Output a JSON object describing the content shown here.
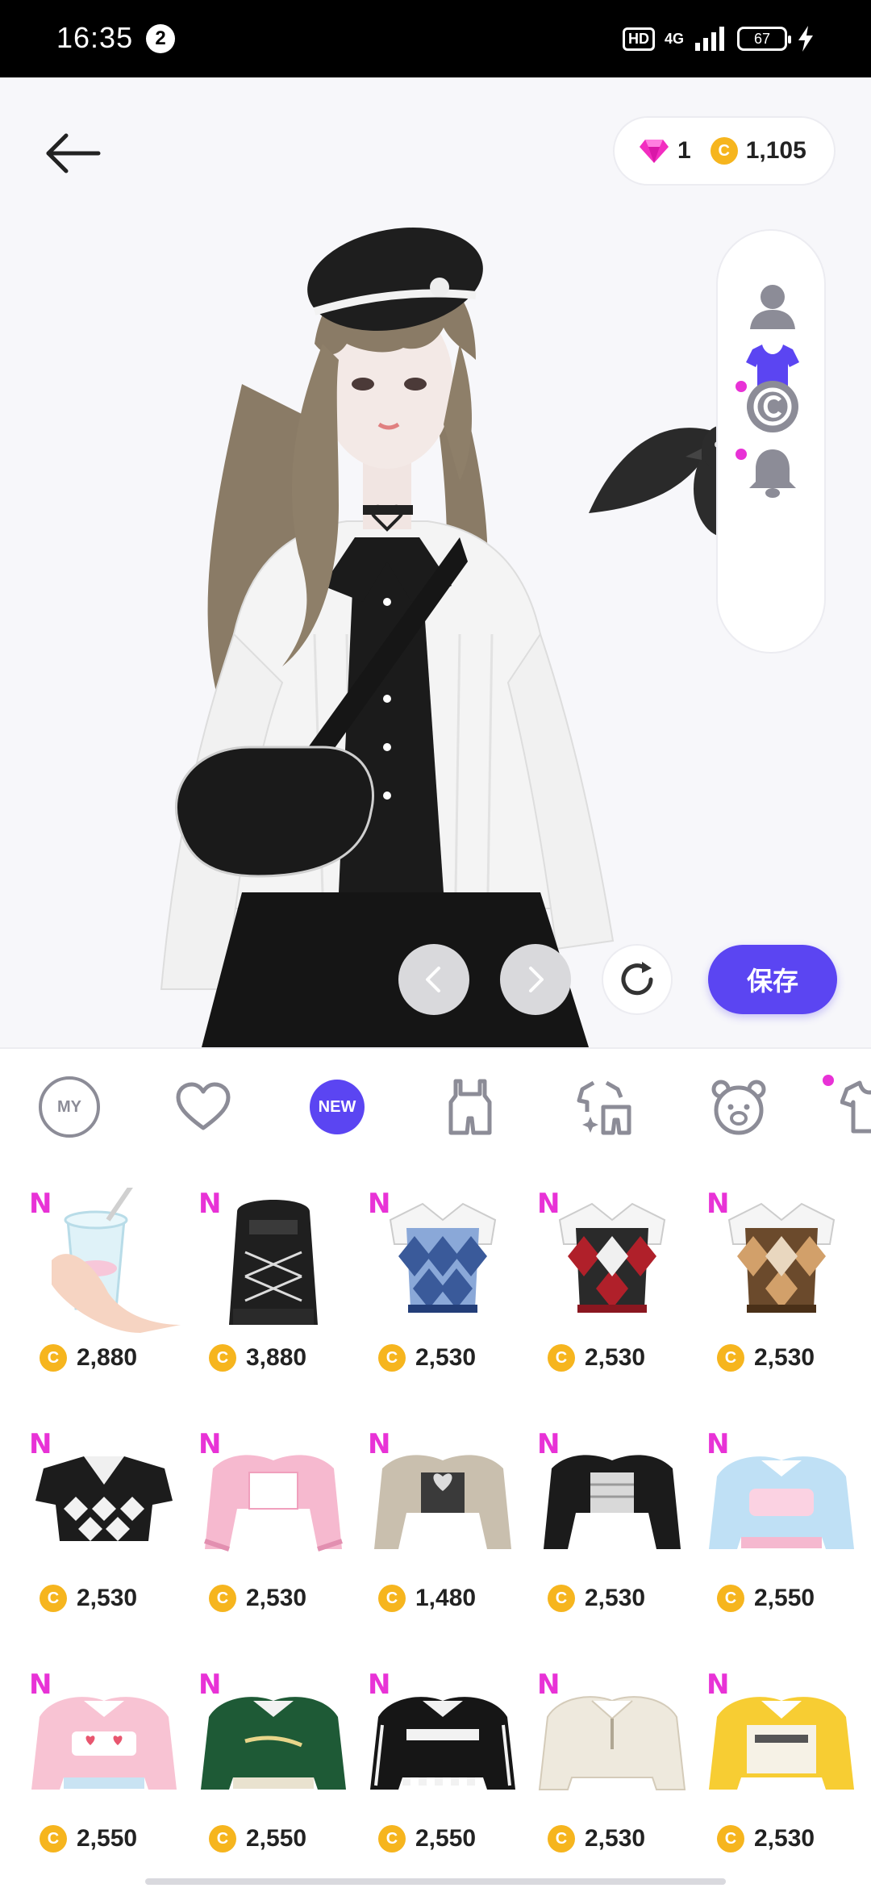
{
  "status_bar": {
    "time": "16:35",
    "notification_count": "2",
    "hd_label": "HD",
    "network_label": "4G",
    "battery_level": "67"
  },
  "header": {
    "gem_count": "1",
    "coin_count": "1,105"
  },
  "side_panel": {
    "items": [
      {
        "icon": "profile-icon",
        "active": false,
        "new_dot": false
      },
      {
        "icon": "shirt-icon",
        "active": true,
        "new_dot": false
      },
      {
        "icon": "copyright-icon",
        "active": false,
        "new_dot": true
      },
      {
        "icon": "bell-icon",
        "active": false,
        "new_dot": true
      }
    ]
  },
  "actions": {
    "save_label": "保存"
  },
  "tabs": [
    {
      "id": "my",
      "label": "MY"
    },
    {
      "id": "favorites",
      "icon": "heart-icon"
    },
    {
      "id": "new",
      "label": "NEW",
      "active": true
    },
    {
      "id": "outfit",
      "icon": "overalls-icon"
    },
    {
      "id": "sets",
      "icon": "sparkle-outfit-icon"
    },
    {
      "id": "animal",
      "icon": "bear-icon"
    },
    {
      "id": "tops",
      "icon": "tshirt-icon",
      "new_dot": true
    }
  ],
  "items": [
    {
      "name": "bubble-tea",
      "badge": "N",
      "price": "2,880"
    },
    {
      "name": "black-backpack",
      "badge": "N",
      "price": "3,880"
    },
    {
      "name": "blue-argyle-vest",
      "badge": "N",
      "price": "2,530"
    },
    {
      "name": "red-argyle-vest",
      "badge": "N",
      "price": "2,530"
    },
    {
      "name": "brown-argyle-vest",
      "badge": "N",
      "price": "2,530"
    },
    {
      "name": "black-argyle-crop",
      "badge": "N",
      "price": "2,530"
    },
    {
      "name": "pink-crop-jacket",
      "badge": "N",
      "price": "2,530"
    },
    {
      "name": "beige-crop-jacket",
      "badge": "N",
      "price": "1,480"
    },
    {
      "name": "black-crop-jacket",
      "badge": "N",
      "price": "2,530"
    },
    {
      "name": "blue-puffer",
      "badge": "N",
      "price": "2,550"
    },
    {
      "name": "pink-puffer",
      "badge": "N",
      "price": "2,550"
    },
    {
      "name": "green-varsity",
      "badge": "N",
      "price": "2,550"
    },
    {
      "name": "black-track-jacket",
      "badge": "N",
      "price": "2,550"
    },
    {
      "name": "cream-pullover",
      "badge": "N",
      "price": "2,530"
    },
    {
      "name": "yellow-puffer",
      "badge": "N",
      "price": "2,530"
    }
  ],
  "colors": {
    "accent": "#5b45f2",
    "badge": "#e832d6",
    "coin": "#f6b51e",
    "icon_grey": "#8c8c97"
  }
}
